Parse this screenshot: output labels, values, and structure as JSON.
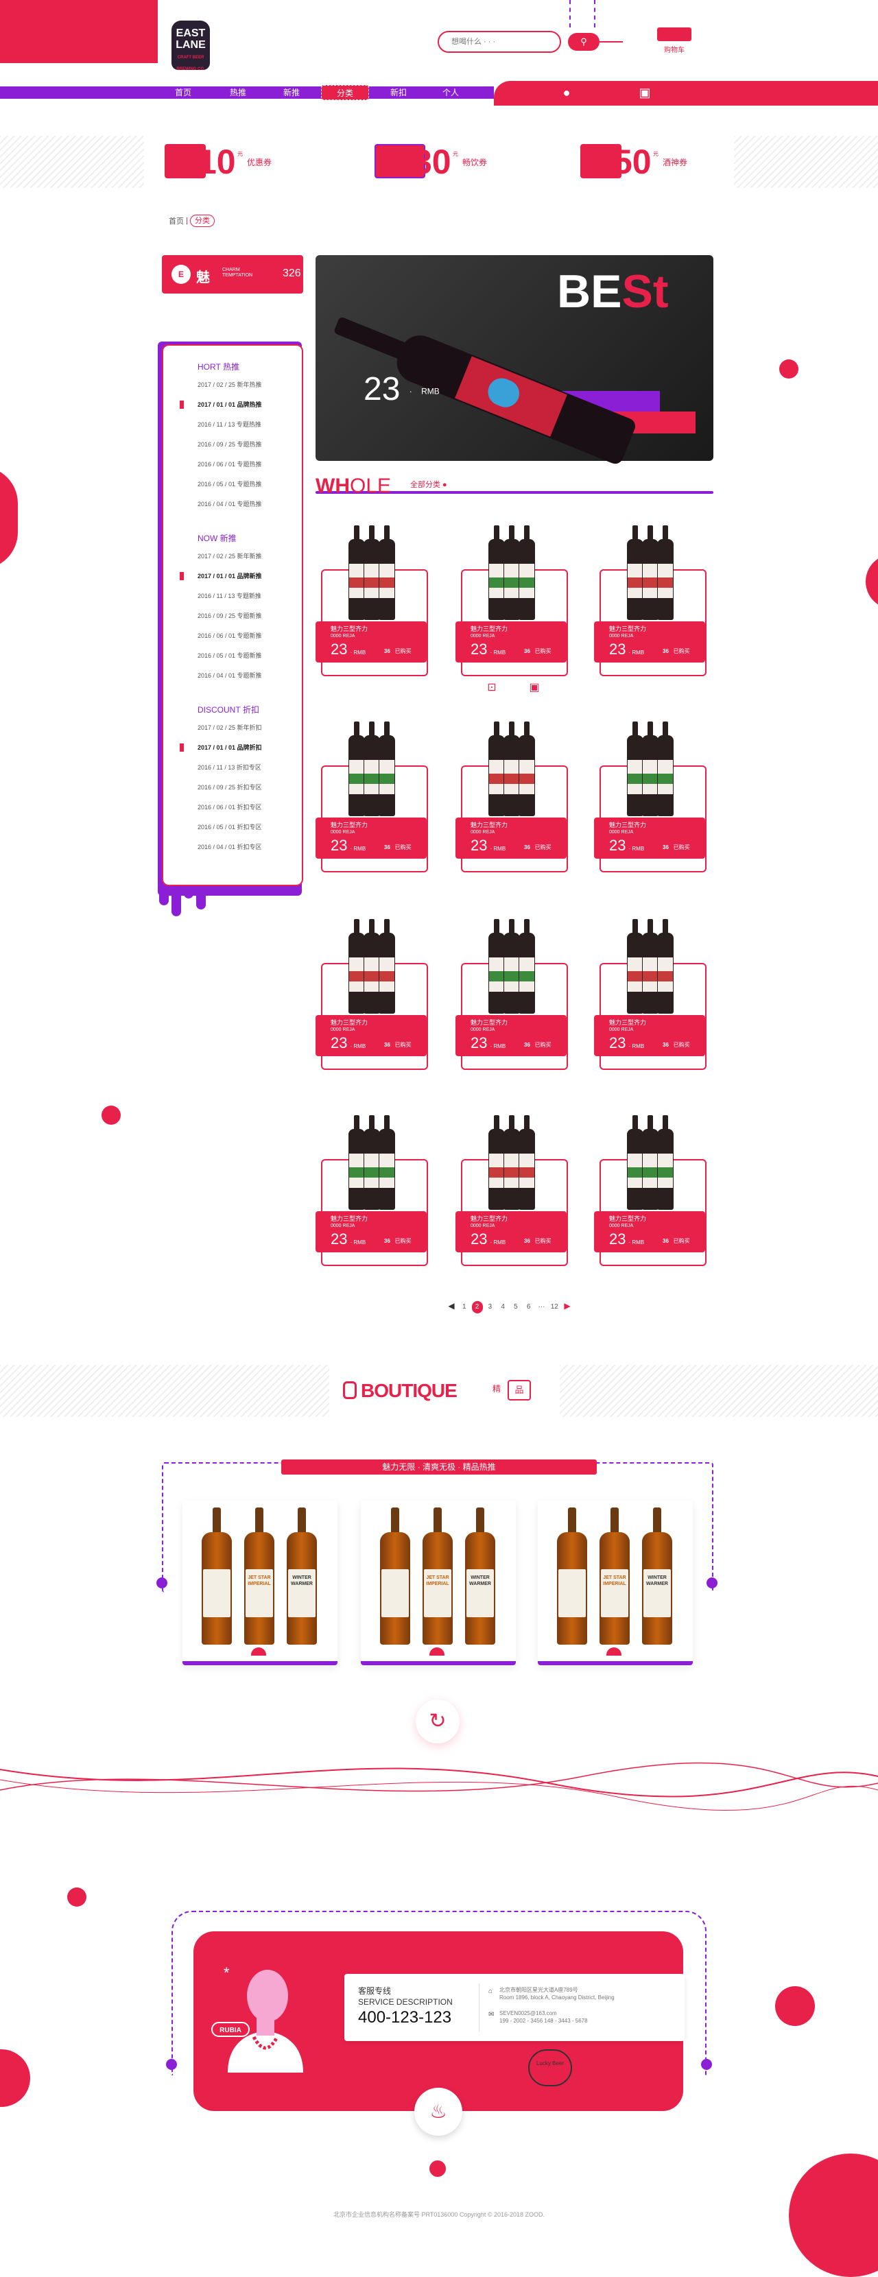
{
  "header": {
    "logo": {
      "line1": "EAST",
      "line2": "LANE",
      "tagline": "CRAFT BEER BREWING CO."
    },
    "search_placeholder": "想喝什么 · · ·",
    "cart_label": "购物车"
  },
  "nav": {
    "items": [
      "首页",
      "热推",
      "新推",
      "分类",
      "新扣",
      "个人"
    ],
    "active": "分类"
  },
  "coupons": [
    {
      "value": "10",
      "unit": "元",
      "label": "优惠券"
    },
    {
      "value": "30",
      "unit": "元",
      "label": "畅饮券"
    },
    {
      "value": "50",
      "unit": "元",
      "label": "酒神券"
    }
  ],
  "breadcrumb": [
    "首页",
    "分类"
  ],
  "sidebar": {
    "title_cn": "魅",
    "title_en_1": "CHARM",
    "title_en_2": "TEMPTATION",
    "count": "326",
    "groups": [
      {
        "en": "HORT",
        "cn": "热推",
        "items": [
          "2017 / 02 / 25 新年热推",
          "2017 / 01 / 01 品牌热推",
          "2016 / 11 / 13 专题热推",
          "2016 / 09 / 25 专题热推",
          "2016 / 06 / 01 专题热推",
          "2016 / 05 / 01 专题热推",
          "2016 / 04 / 01 专题热推"
        ],
        "highlight": 1
      },
      {
        "en": "NOW",
        "cn": "新推",
        "items": [
          "2017 / 02 / 25 新年新推",
          "2017 / 01 / 01 品牌新推",
          "2016 / 11 / 13 专题新推",
          "2016 / 09 / 25 专题新推",
          "2016 / 06 / 01 专题新推",
          "2016 / 05 / 01 专题新推",
          "2016 / 04 / 01 专题新推"
        ],
        "highlight": 1
      },
      {
        "en": "DISCOUNT",
        "cn": "折扣",
        "items": [
          "2017 / 02 / 25 新年折扣",
          "2017 / 01 / 01 品牌折扣",
          "2016 / 11 / 13 折扣专区",
          "2016 / 09 / 25 折扣专区",
          "2016 / 06 / 01 折扣专区",
          "2016 / 05 / 01 折扣专区",
          "2016 / 04 / 01 折扣专区"
        ],
        "highlight": 1
      }
    ]
  },
  "banner": {
    "headline_white": "BE",
    "headline_red": "St",
    "price": "23",
    "currency": "RMB"
  },
  "whole": {
    "title_bold": "WH",
    "title_light": "OLE",
    "subtitle": "全部分类"
  },
  "product_template": {
    "name": "魅力三型齐力",
    "code": "0000 REJA",
    "price": "23",
    "currency": "RMB",
    "sold_count": "36",
    "sold_label": "已购买"
  },
  "products": [
    {
      "label_color": "#c83b3b"
    },
    {
      "label_color": "#3c8a3c"
    },
    {
      "label_color": "#c83b3b"
    },
    {
      "label_color": "#3c8a3c"
    },
    {
      "label_color": "#c83b3b"
    },
    {
      "label_color": "#3c8a3c"
    },
    {
      "label_color": "#c83b3b"
    },
    {
      "label_color": "#3c8a3c"
    },
    {
      "label_color": "#c83b3b"
    },
    {
      "label_color": "#3c8a3c"
    },
    {
      "label_color": "#c83b3b"
    },
    {
      "label_color": "#3c8a3c"
    }
  ],
  "pager": {
    "prev": "◀",
    "pages": [
      "1",
      "2",
      "3",
      "4",
      "5",
      "6",
      "···",
      "12"
    ],
    "current": "2",
    "next": "▶"
  },
  "boutique": {
    "title": "BOUTIQUE",
    "cn_small": "精",
    "cn_box": "品",
    "bar_text": "魅力无限 · 清爽无极 · 精品热推"
  },
  "boutique_labels": [
    "JET STAR IMPERIAL",
    "WINTER WARMER"
  ],
  "footer": {
    "hotline_cn": "客服专线",
    "hotline_en": "SERVICE DESCRIPTION",
    "phone": "400-123-123",
    "address_cn": "北京市朝阳区星光大道A座789号",
    "address_en": "Room 1896, block A, Chaoyang District, Beijing",
    "email": "SEVEN0025@163.com",
    "phones": "199 - 2002 - 3456   148 - 3443 - 5678",
    "badge": "RUBIA",
    "copyright": "北京市企业信息机构名称备案号 PRT0136000   Copyright © 2016-2018 ZOOD.",
    "doodle": "Lucky Beer"
  },
  "colors": {
    "accent": "#e8214a",
    "secondary": "#8a1fd6"
  }
}
